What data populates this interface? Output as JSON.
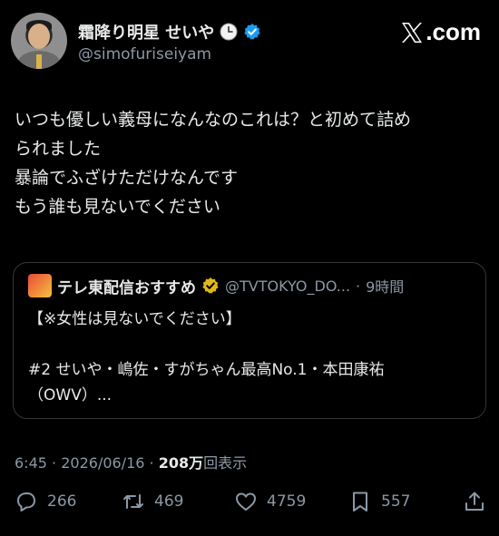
{
  "author": {
    "display_name": "霜降り明星 せいや",
    "handle": "@simofuriseiyam"
  },
  "brand": {
    "label": ".com"
  },
  "tweet": {
    "lines": [
      "いつも優しい義母になんなのこれは？と初めて詰め",
      "られました",
      "暴論でふざけただけなんです",
      "もう誰も見ないでください"
    ]
  },
  "quote": {
    "name": "テレ東配信おすすめ",
    "handle": "@TVTOKYO_DO...",
    "separator": "·",
    "time": "9時間",
    "lines": [
      "【※女性は見ないでください】",
      "#2 せいや・嶋佐・すがちゃん最高No.1・本田康祐",
      "（OWV）..."
    ]
  },
  "meta": {
    "time": "6:45",
    "date": "2026/06/16",
    "separator": "·",
    "views_count": "208万",
    "views_label": "回表示"
  },
  "actions": {
    "replies": "266",
    "reposts": "469",
    "likes": "4759",
    "bookmarks": "557"
  },
  "colors": {
    "background": "#000000",
    "text": "#e7e9ea",
    "muted": "#8b98a5",
    "verified_blue": "#1d9bf0",
    "verified_gold": "#e2b719"
  }
}
